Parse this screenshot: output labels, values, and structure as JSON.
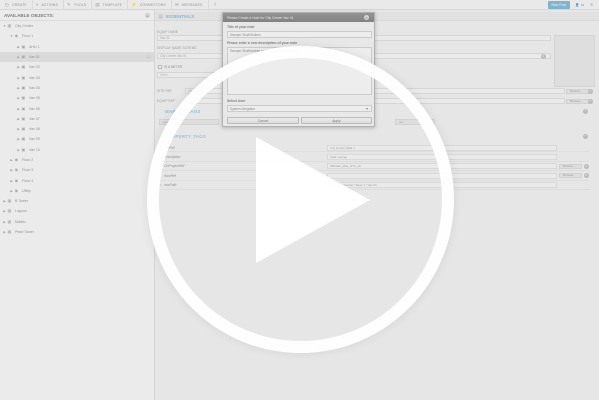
{
  "toolbar": {
    "items": [
      {
        "icon": "circle-icon",
        "glyph": "◴",
        "label": "CREATE"
      },
      {
        "icon": "lightning-icon",
        "glyph": "ϟ",
        "label": "ACTIONS"
      },
      {
        "icon": "wrench-icon",
        "glyph": "✎",
        "label": "TOOLS"
      },
      {
        "icon": "template-icon",
        "glyph": "▤",
        "label": "TEMPLATE"
      },
      {
        "icon": "connector-icon",
        "glyph": "⚡",
        "label": "CONNECTORS"
      },
      {
        "icon": "message-icon",
        "glyph": "✉",
        "label": "MESSAGES"
      }
    ],
    "info_glyph": "i",
    "new_button": "New Post",
    "user_label": "ta",
    "menu_glyph": "≡"
  },
  "sidebar": {
    "title": "AVAILABLE OBJECTS:",
    "min_glyph": "–",
    "rows": [
      {
        "label": "City Center",
        "level": 0,
        "arrow": "▼",
        "icon": "building-icon",
        "glyph": "▦"
      },
      {
        "label": "Floor 1",
        "level": 1,
        "arrow": "▼",
        "icon": "floor-icon",
        "glyph": "◉"
      },
      {
        "label": "AHU 1",
        "level": 2,
        "arrow": "▶",
        "icon": "equip-icon",
        "glyph": "▣"
      },
      {
        "label": "Vav 01",
        "level": 2,
        "arrow": "▶",
        "icon": "equip-icon",
        "glyph": "▣",
        "selected": true,
        "dots": "⋯"
      },
      {
        "label": "Vav 02",
        "level": 2,
        "arrow": "▶",
        "icon": "equip-icon",
        "glyph": "▣"
      },
      {
        "label": "Vav 03",
        "level": 2,
        "arrow": "▶",
        "icon": "equip-icon",
        "glyph": "▣"
      },
      {
        "label": "Vav 04",
        "level": 2,
        "arrow": "▶",
        "icon": "equip-icon",
        "glyph": "▣"
      },
      {
        "label": "Vav 05",
        "level": 2,
        "arrow": "▶",
        "icon": "equip-icon",
        "glyph": "▣"
      },
      {
        "label": "Vav 06",
        "level": 2,
        "arrow": "▶",
        "icon": "equip-icon",
        "glyph": "▣"
      },
      {
        "label": "Vav 07",
        "level": 2,
        "arrow": "▶",
        "icon": "equip-icon",
        "glyph": "▣"
      },
      {
        "label": "Vav 08",
        "level": 2,
        "arrow": "▶",
        "icon": "equip-icon",
        "glyph": "▣"
      },
      {
        "label": "Vav 09",
        "level": 2,
        "arrow": "▶",
        "icon": "equip-icon",
        "glyph": "▣"
      },
      {
        "label": "Vav 10",
        "level": 2,
        "arrow": "▶",
        "icon": "equip-icon",
        "glyph": "▣"
      },
      {
        "label": "Floor 2",
        "level": 1,
        "arrow": "▶",
        "icon": "floor-icon",
        "glyph": "◉"
      },
      {
        "label": "Floor 3",
        "level": 1,
        "arrow": "▶",
        "icon": "floor-icon",
        "glyph": "◉"
      },
      {
        "label": "Floor 4",
        "level": 1,
        "arrow": "▶",
        "icon": "floor-icon",
        "glyph": "◉"
      },
      {
        "label": "Utility",
        "level": 1,
        "arrow": "▶",
        "icon": "floor-icon",
        "glyph": "◉"
      },
      {
        "label": "B Tower",
        "level": 0,
        "arrow": "▶",
        "icon": "building-icon",
        "glyph": "▦"
      },
      {
        "label": "Lagoon",
        "level": 0,
        "arrow": "▶",
        "icon": "building-icon",
        "glyph": "▦"
      },
      {
        "label": "Malibu",
        "level": 0,
        "arrow": "▶",
        "icon": "building-icon",
        "glyph": "▦"
      },
      {
        "label": "Pearl Tower",
        "level": 0,
        "arrow": "▶",
        "icon": "building-icon",
        "glyph": "▦"
      }
    ]
  },
  "main": {
    "section_title": "ESSENTIALS",
    "min_glyph": "–",
    "equip_name_label": "EQUIP NAME",
    "equip_name_value": "Vav 01",
    "display_scheme_label": "DISPLAY NAME SCHEME",
    "display_scheme_value": "City Center Vav 01",
    "is_meter_label": "IS A METER",
    "meter_placeholder": "Meter...",
    "site_ref_label": "SITE REF",
    "site_ref_value": "City Center",
    "equip_ref_label": "EQUIP REF",
    "browse_label": "Browse...",
    "clear_glyph": "✕",
    "marker_tags_title": "MARKER TAGS",
    "marker_chips": [
      "equip",
      "vav"
    ],
    "add_glyph": "+",
    "property_tags_title": "PROPERTY TAGS",
    "property_rows": [
      {
        "name": "siteRef",
        "value": "City Center Walk 1",
        "browse": false
      },
      {
        "name": "description",
        "value": "Cafe Lounge",
        "browse": false
      },
      {
        "name": "OnProjectRef",
        "value": "3Mtrack_iaHs_HTC_fm",
        "browse": true
      },
      {
        "name": "floorRef",
        "value": "",
        "browse": true
      },
      {
        "name": "navPath",
        "value": "equip-City Center / Floor 1 / Vav 01",
        "browse": false
      }
    ]
  },
  "modal": {
    "title": "Please Create a Note for City Center Vav 01",
    "close_glyph": "✕",
    "note_title_label": "Title of your note",
    "note_title_value": "Damper Shaft Broken",
    "description_label": "Please enter a new description of your note",
    "description_value": "Damper Shaft broken needs replacing tomorrow",
    "user_label": "Select User",
    "user_value": "System Integrator",
    "cancel_label": "Cancel",
    "apply_label": "Apply"
  },
  "overlay": {
    "play_icon": "play-icon"
  }
}
